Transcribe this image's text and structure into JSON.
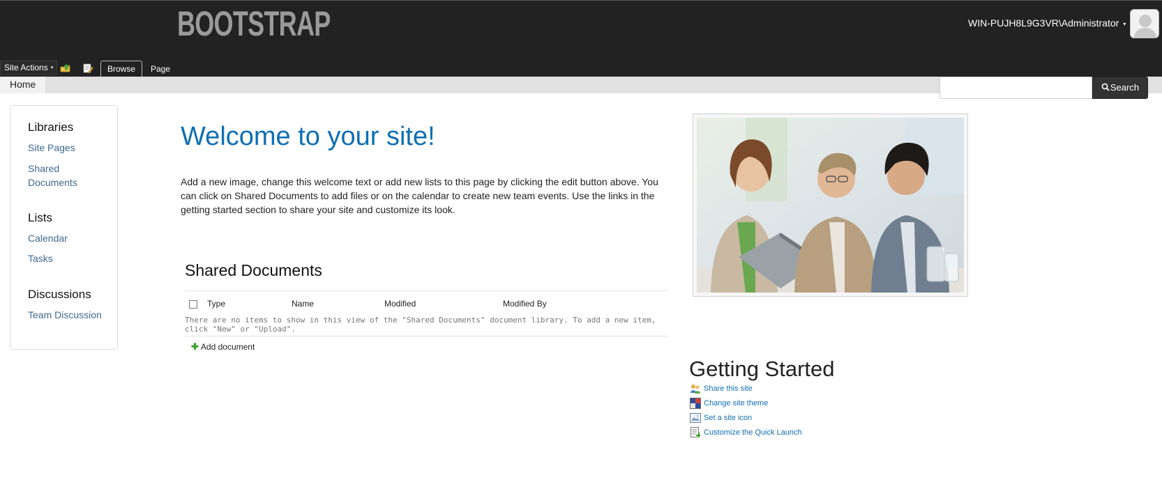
{
  "header": {
    "logo_text": "BOOTSTRAP",
    "user_name": "WIN-PUJH8L9G3VR\\Administrator",
    "user_caret": "▾",
    "avatar_icon": "user-silhouette-icon"
  },
  "ribbon": {
    "site_actions_label": "Site Actions",
    "site_actions_caret": "▾",
    "icons": [
      "navigate-up-icon",
      "edit-page-icon"
    ],
    "tabs": [
      {
        "label": "Browse",
        "selected": true
      },
      {
        "label": "Page",
        "selected": false
      }
    ]
  },
  "navbar": {
    "home_label": "Home"
  },
  "search": {
    "placeholder": "",
    "button_label": "Search",
    "icon": "search-icon"
  },
  "quick_launch": {
    "sections": [
      {
        "heading": "Libraries",
        "links": [
          "Site Pages",
          "Shared Documents"
        ]
      },
      {
        "heading": "Lists",
        "links": [
          "Calendar",
          "Tasks"
        ]
      },
      {
        "heading": "Discussions",
        "links": [
          "Team Discussion"
        ]
      }
    ]
  },
  "welcome": {
    "title": "Welcome to your site!",
    "text": "Add a new image, change this welcome text or add new lists to this page by clicking the edit button above. You can click on Shared Documents to add files or on the calendar to create new team events. Use the links in the getting started section to share your site and customize its look."
  },
  "shared_documents": {
    "title": "Shared Documents",
    "columns": [
      "Type",
      "Name",
      "Modified",
      "Modified By"
    ],
    "empty_message": "There are no items to show in this view of the \"Shared Documents\" document library. To add a new item, click \"New\" or \"Upload\".",
    "add_label": "Add document"
  },
  "image": {
    "icon": "team-photo"
  },
  "getting_started": {
    "title": "Getting Started",
    "items": [
      {
        "label": "Share this site",
        "icon": "share-site-icon"
      },
      {
        "label": "Change site theme",
        "icon": "theme-icon"
      },
      {
        "label": "Set a site icon",
        "icon": "site-icon-icon"
      },
      {
        "label": "Customize the Quick Launch",
        "icon": "quick-launch-icon"
      }
    ]
  },
  "colors": {
    "header_bg": "#222222",
    "accent_blue": "#0f6fb3",
    "nav_link": "#3f6a8f",
    "navbar_bg": "#e1e1e1"
  }
}
